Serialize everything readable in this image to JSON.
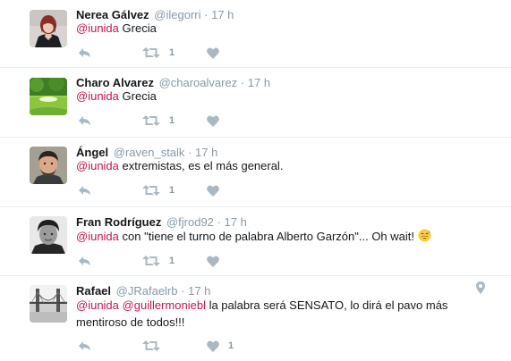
{
  "tweets": [
    {
      "name": "Nerea Gálvez",
      "handle": "@ilegorri",
      "separator": "·",
      "time": "17 h",
      "mentions": [
        "@iunida"
      ],
      "text": "Grecia",
      "retweets": "1",
      "likes": ""
    },
    {
      "name": "Charo Alvarez",
      "handle": "@charoalvarez",
      "separator": "·",
      "time": "17 h",
      "mentions": [
        "@iunida"
      ],
      "text": "Grecia",
      "retweets": "1",
      "likes": ""
    },
    {
      "name": "Ángel",
      "handle": "@raven_stalk",
      "separator": "·",
      "time": "17 h",
      "mentions": [
        "@iunida"
      ],
      "text": "extremistas, es el más general.",
      "retweets": "1",
      "likes": ""
    },
    {
      "name": "Fran Rodríguez",
      "handle": "@fjrod92",
      "separator": "·",
      "time": "17 h",
      "mentions": [
        "@iunida"
      ],
      "text": "con \"tiene el turno de palabra Alberto Garzón\"... Oh wait!",
      "emoji": "sweat-smile-emoji",
      "retweets": "1",
      "likes": ""
    },
    {
      "name": "Rafael",
      "handle": "@JRafaelrb",
      "separator": "·",
      "time": "17 h",
      "mentions": [
        "@iunida",
        "@guillermoniebl"
      ],
      "text": "la palabra será SENSATO, lo dirá el pavo más mentiroso de todos!!!",
      "retweets": "",
      "likes": "1",
      "geo_icon": "location-pin-icon"
    }
  ],
  "colors": {
    "mention": "#c4174b",
    "meta": "#8899a6",
    "icon": "#aab8c2",
    "divider": "#e6ecf0"
  }
}
